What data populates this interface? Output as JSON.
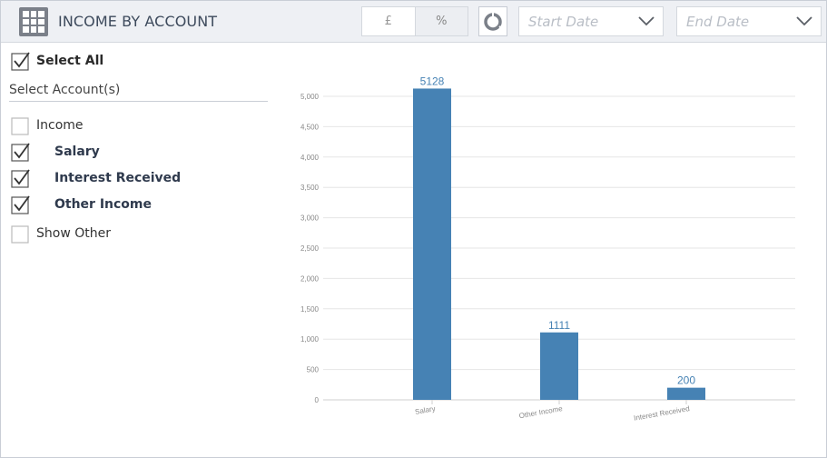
{
  "header": {
    "title": "INCOME BY ACCOUNT",
    "currency_toggle": "£",
    "percent_toggle": "%",
    "start_date_placeholder": "Start Date",
    "end_date_placeholder": "End Date"
  },
  "sidebar": {
    "select_all_label": "Select All",
    "select_all_checked": true,
    "section_label": "Select Account(s)",
    "items": [
      {
        "label": "Income",
        "checked": false,
        "bold": false
      },
      {
        "label": "Salary",
        "checked": true,
        "bold": true
      },
      {
        "label": "Interest Received",
        "checked": true,
        "bold": true
      },
      {
        "label": "Other Income",
        "checked": true,
        "bold": true
      },
      {
        "label": "Show Other",
        "checked": false,
        "bold": false
      }
    ]
  },
  "colors": {
    "bar": "#4682b4",
    "label": "#4682b4",
    "grid": "#e6e6e6"
  },
  "chart_data": {
    "type": "bar",
    "categories": [
      "Salary",
      "Other Income",
      "Interest Received"
    ],
    "values": [
      5128,
      1111,
      200
    ],
    "ylim": [
      0,
      5000
    ],
    "yticks": [
      0,
      500,
      1000,
      1500,
      2000,
      2500,
      3000,
      3500,
      4000,
      4500,
      5000
    ],
    "ytick_labels": [
      "0",
      "500",
      "1,000",
      "1,500",
      "2,000",
      "2,500",
      "3,000",
      "3,500",
      "4,000",
      "4,500",
      "5,000"
    ],
    "data_labels": [
      "5128",
      "1111",
      "200"
    ],
    "grid": true,
    "title": "",
    "xlabel": "",
    "ylabel": ""
  }
}
